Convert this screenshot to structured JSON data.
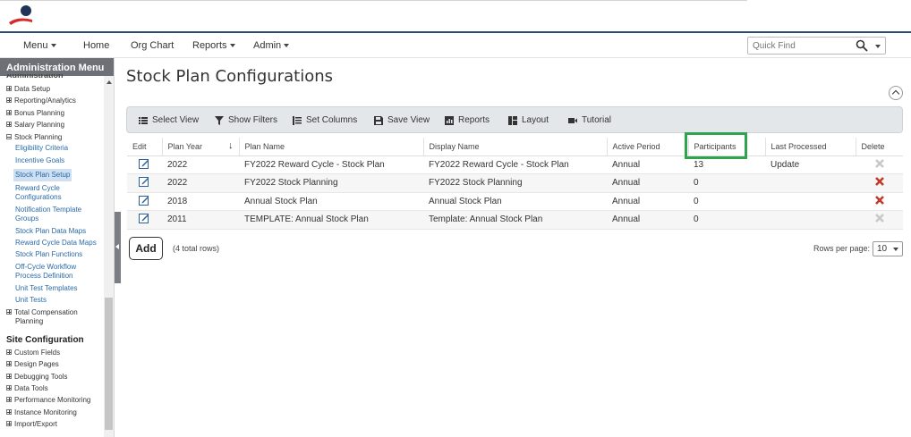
{
  "nav": {
    "menu": "Menu",
    "home": "Home",
    "org_chart": "Org Chart",
    "reports": "Reports",
    "admin": "Admin",
    "quick_find_placeholder": "Quick Find"
  },
  "sidebar": {
    "title": "Administration Menu",
    "subtitle_cut": "Administration",
    "items": [
      {
        "label": "Data Setup",
        "type": "plus"
      },
      {
        "label": "Reporting/Analytics",
        "type": "plus"
      },
      {
        "label": "Bonus Planning",
        "type": "plus"
      },
      {
        "label": "Salary Planning",
        "type": "plus"
      },
      {
        "label": "Stock Planning",
        "type": "minus"
      }
    ],
    "stock_links": [
      "Eligibility Criteria",
      "Incentive Goals",
      "Stock Plan Setup",
      "Reward Cycle",
      "Configurations",
      "Notification Template",
      "Groups",
      "Stock Plan Data Maps",
      "Reward Cycle Data Maps",
      "Stock Plan Functions",
      "Off-Cycle Workflow",
      "Process Definition",
      "Unit Test Templates",
      "Unit Tests"
    ],
    "total_comp": [
      "Total Compensation",
      "Planning"
    ],
    "site_config_title": "Site Configuration",
    "site_items": [
      "Custom Fields",
      "Design Pages",
      "Debugging Tools",
      "Data Tools",
      "Performance Monitoring",
      "Instance Monitoring",
      "Import/Export"
    ]
  },
  "page": {
    "title": "Stock Plan Configurations"
  },
  "toolbar": {
    "select_view": "Select View",
    "show_filters": "Show Filters",
    "set_columns": "Set Columns",
    "save_view": "Save View",
    "reports": "Reports",
    "layout": "Layout",
    "tutorial": "Tutorial"
  },
  "table": {
    "headers": [
      "Edit",
      "Plan Year",
      "Plan Name",
      "Display Name",
      "Active Period",
      "Participants",
      "Last Processed",
      "Delete"
    ],
    "rows": [
      {
        "year": "2022",
        "plan_name": "FY2022 Reward Cycle - Stock Plan",
        "display_name": "FY2022 Reward Cycle - Stock Plan",
        "period": "Annual",
        "participants": "13",
        "last_processed": "Update",
        "delete_enabled": false
      },
      {
        "year": "2022",
        "plan_name": "FY2022 Stock Planning",
        "display_name": "FY2022 Stock Planning",
        "period": "Annual",
        "participants": "0",
        "last_processed": "",
        "delete_enabled": true
      },
      {
        "year": "2018",
        "plan_name": "Annual Stock Plan",
        "display_name": "Annual Stock Plan",
        "period": "Annual",
        "participants": "0",
        "last_processed": "",
        "delete_enabled": true
      },
      {
        "year": "2011",
        "plan_name": "TEMPLATE: Annual Stock Plan",
        "display_name": "Template: Annual Stock Plan",
        "period": "Annual",
        "participants": "0",
        "last_processed": "",
        "delete_enabled": false
      }
    ]
  },
  "footer": {
    "add": "Add",
    "total_rows": "(4 total rows)",
    "rows_per_page_label": "Rows per page:",
    "rows_per_page_value": "10"
  },
  "colors": {
    "brand_navy": "#2c4a6e",
    "brand_red": "#d62b2b",
    "highlight_green": "#2ea44f",
    "delete_red": "#c0392b"
  }
}
